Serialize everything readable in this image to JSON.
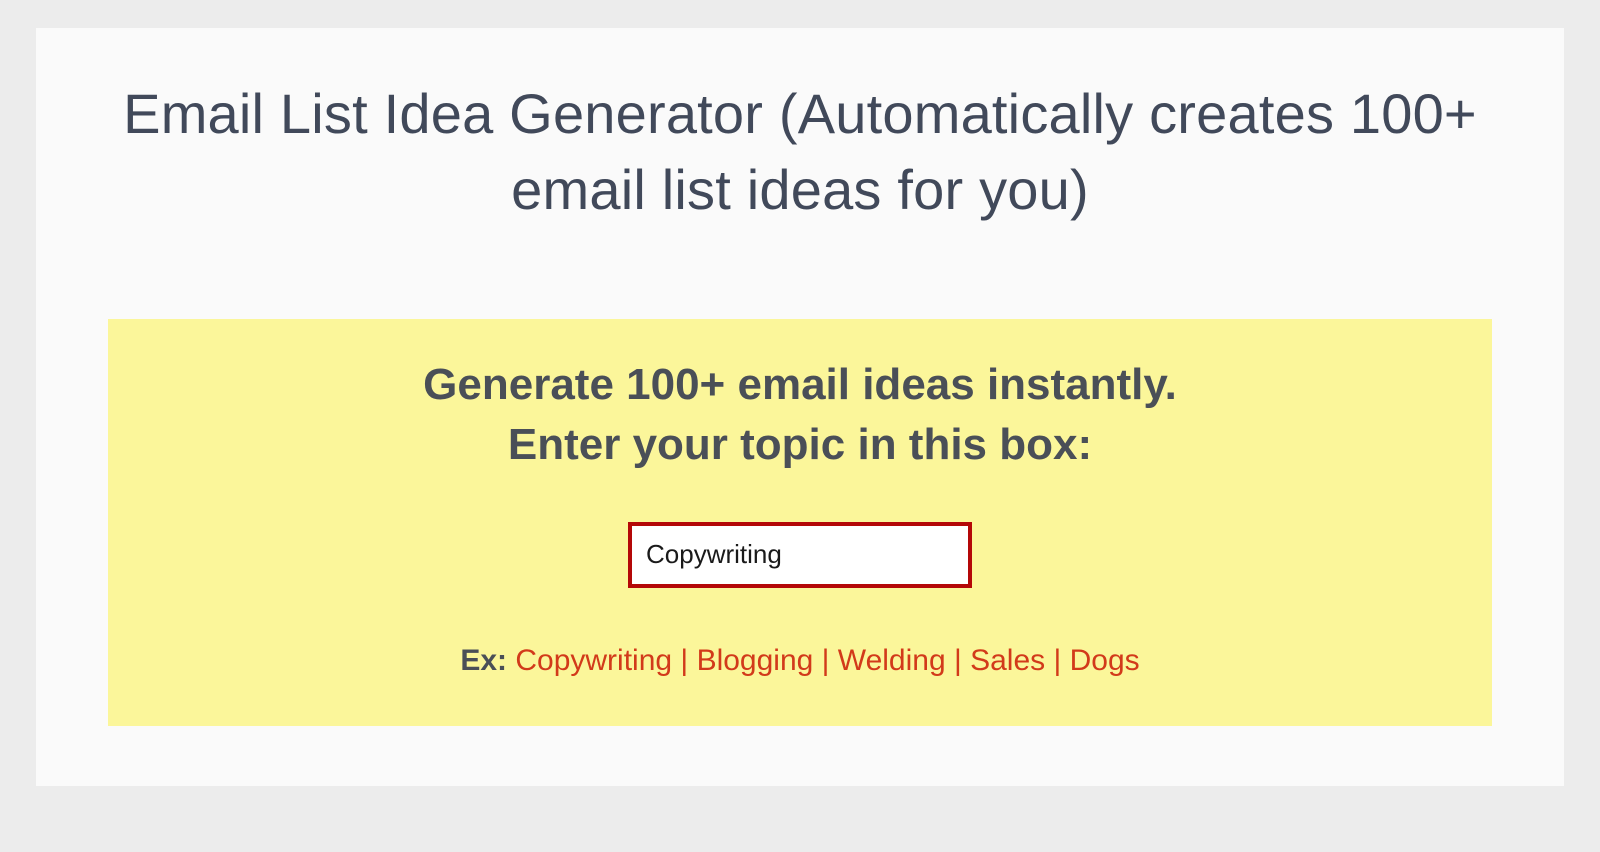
{
  "header": {
    "title": "Email List Idea Generator (Automatically creates 100+ email list ideas for you)"
  },
  "prompt": {
    "heading_line1": "Generate 100+ email ideas instantly.",
    "heading_line2": "Enter your topic in this box:",
    "input_value": "Copywriting"
  },
  "examples": {
    "label": "Ex:",
    "separator": " | ",
    "items": [
      "Copywriting",
      "Blogging",
      "Welding",
      "Sales",
      "Dogs"
    ]
  }
}
